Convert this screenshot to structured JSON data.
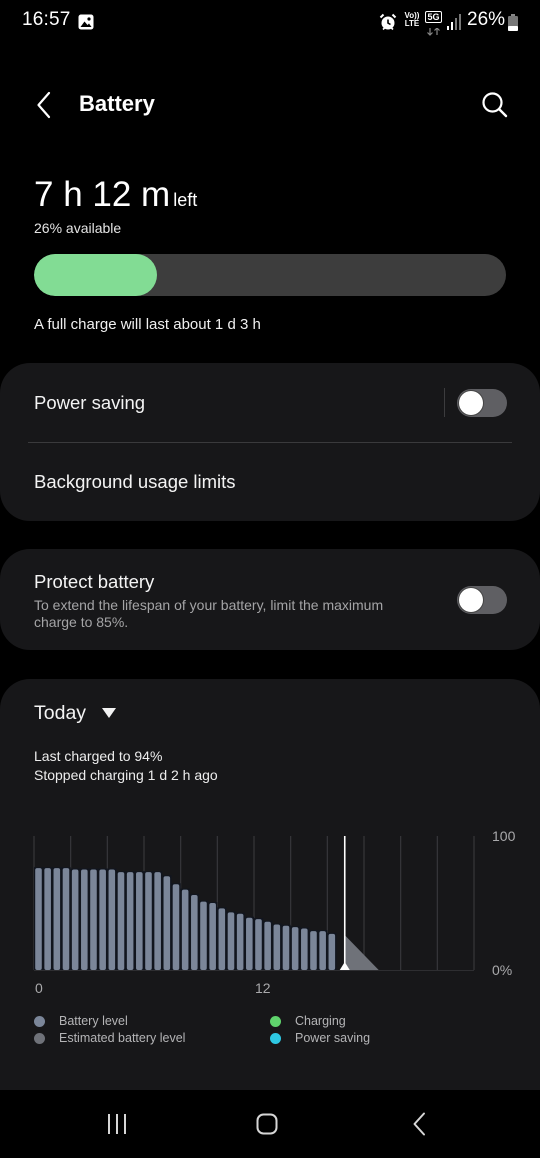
{
  "status_bar": {
    "time": "16:57",
    "notification_icons": [
      "gallery-icon"
    ],
    "system_icons": [
      "alarm-icon",
      "volte-icon",
      "5g-icon",
      "signal-icon"
    ],
    "volte_top": "Vo))",
    "volte_bottom": "LTE",
    "network_label": "5G",
    "battery_percent": "26%",
    "battery_icon": "battery-icon"
  },
  "header": {
    "title": "Battery",
    "back_icon": "chevron-left-icon",
    "search_icon": "search-icon"
  },
  "summary": {
    "time_left": "7 h 12 m",
    "time_left_suffix": "left",
    "available": "26% available",
    "level_percent": 26,
    "full_charge_text": "A full charge will last about 1 d 3 h"
  },
  "settings_card": {
    "power_saving": {
      "label": "Power saving",
      "enabled": false
    },
    "background_usage_limits": {
      "label": "Background usage limits"
    }
  },
  "protect_card": {
    "label": "Protect battery",
    "description": "To extend the lifespan of your battery, limit the maximum charge to 85%.",
    "enabled": false
  },
  "usage_card": {
    "period_label": "Today",
    "last_charged": "Last charged to 94%",
    "stopped_charging": "Stopped charging 1 d 2 h ago"
  },
  "colors": {
    "level_fill": "#82dc94",
    "level_track": "#3d3d3d",
    "battery_level": "#7b8699",
    "estimated_level": "#6f7279",
    "charging": "#5fd36c",
    "power_saving": "#2ec8e3",
    "current_time_marker": "#ffffff"
  },
  "chart_data": {
    "type": "bar",
    "title": "",
    "xlabel": "",
    "ylabel": "",
    "x_unit": "hour of day",
    "x_range": [
      0,
      24
    ],
    "ylim": [
      0,
      100
    ],
    "grid": true,
    "grid_interval_hours": 2,
    "bar_interval_hours": 0.5,
    "x_ticks": [
      {
        "value": 0,
        "label": "0"
      },
      {
        "value": 12,
        "label": "12"
      }
    ],
    "y_ticks": [
      {
        "value": 100,
        "label": "100"
      },
      {
        "value": 0,
        "label": "0%"
      }
    ],
    "current_time_hours": 16.95,
    "series": [
      {
        "name": "Battery level",
        "type": "bar",
        "x": [
          0,
          0.5,
          1,
          1.5,
          2,
          2.5,
          3,
          3.5,
          4,
          4.5,
          5,
          5.5,
          6,
          6.5,
          7,
          7.5,
          8,
          8.5,
          9,
          9.5,
          10,
          10.5,
          11,
          11.5,
          12,
          12.5,
          13,
          13.5,
          14,
          14.5,
          15,
          15.5,
          16
        ],
        "values": [
          76,
          76,
          76,
          76,
          75,
          75,
          75,
          75,
          75,
          73,
          73,
          73,
          73,
          73,
          70,
          64,
          60,
          56,
          51,
          50,
          46,
          43,
          42,
          39,
          38,
          36,
          34,
          33,
          32,
          31,
          29,
          29,
          27
        ]
      },
      {
        "name": "Estimated battery level",
        "type": "area",
        "points": [
          [
            16.95,
            26
          ],
          [
            18.8,
            0
          ]
        ]
      }
    ],
    "legend": [
      {
        "label": "Battery level",
        "color": "#7b8699"
      },
      {
        "label": "Estimated battery level",
        "color": "#6f7279"
      },
      {
        "label": "Charging",
        "color": "#5fd36c"
      },
      {
        "label": "Power saving",
        "color": "#2ec8e3"
      }
    ],
    "legend_position": "bottom"
  },
  "nav_bar": {
    "recents_icon": "recents-icon",
    "home_icon": "home-icon",
    "back_icon": "back-icon"
  }
}
